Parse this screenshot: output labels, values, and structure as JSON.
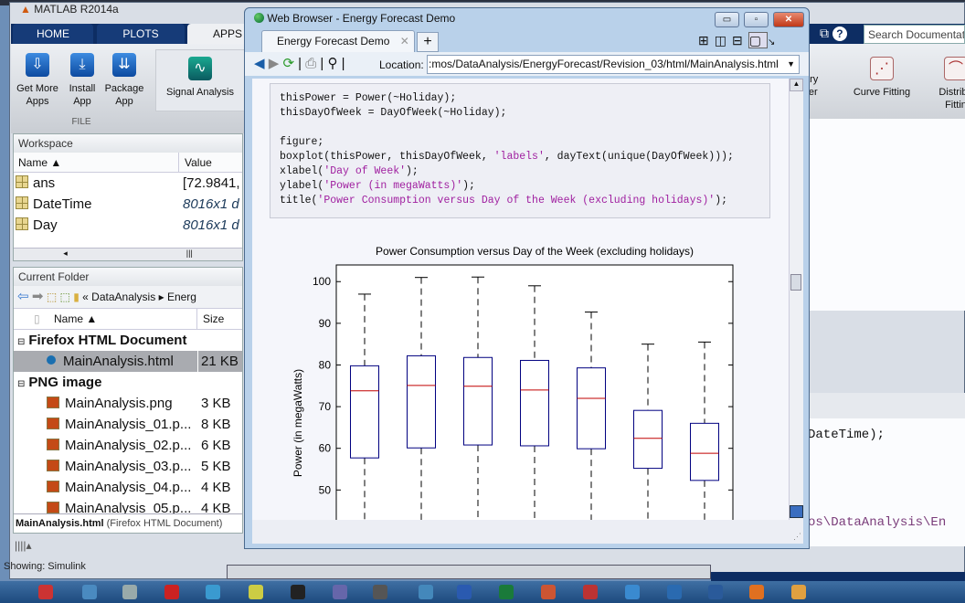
{
  "matlab": {
    "title": "MATLAB R2014a",
    "tabs": [
      "HOME",
      "PLOTS",
      "APPS"
    ],
    "ribbon": {
      "buttons": [
        "Get More\nApps",
        "Install\nApp",
        "Package\nApp"
      ],
      "group": "FILE",
      "apps": [
        "Signal Analysis",
        "ary\niler",
        "Curve Fitting",
        "Distribu\nFittin"
      ]
    },
    "search_placeholder": "Search Documentation",
    "workspace": {
      "title": "Workspace",
      "columns": [
        "Name ▲",
        "Value"
      ],
      "rows": [
        {
          "name": "ans",
          "value": "[72.9841,"
        },
        {
          "name": "DateTime",
          "value": "8016x1 d"
        },
        {
          "name": "Day",
          "value": "8016x1 d"
        }
      ]
    },
    "folder": {
      "title": "Current Folder",
      "breadcrumb": [
        "« DataAnalysis",
        "▸",
        "Energ"
      ],
      "columns": [
        "Name ▲",
        "Size"
      ],
      "groups": [
        {
          "name": "Firefox HTML Document",
          "files": [
            {
              "name": "MainAnalysis.html",
              "size": "21 KB"
            }
          ]
        },
        {
          "name": "PNG image",
          "files": [
            {
              "name": "MainAnalysis.png",
              "size": "3 KB"
            },
            {
              "name": "MainAnalysis_01.p...",
              "size": "8 KB"
            },
            {
              "name": "MainAnalysis_02.p...",
              "size": "6 KB"
            },
            {
              "name": "MainAnalysis_03.p...",
              "size": "5 KB"
            },
            {
              "name": "MainAnalysis_04.p...",
              "size": "4 KB"
            },
            {
              "name": "MainAnalysis_05.p...",
              "size": "4 KB"
            }
          ]
        }
      ],
      "details_name": "MainAnalysis.html",
      "details_type": "(Firefox HTML Document)"
    },
    "status": "Showing: Simulink",
    "command_lines": [
      "DateTime);",
      "os\\DataAnalysis\\En"
    ]
  },
  "browser": {
    "title": "Web Browser - Energy Forecast Demo",
    "tab": "Energy Forecast Demo",
    "location_label": "Location:",
    "location": ":mos/DataAnalysis/EnergyForecast/Revision_03/html/MainAnalysis.html",
    "code": [
      [
        [
          "thisPower = Power(~Holiday);",
          ""
        ]
      ],
      [
        [
          "thisDayOfWeek = DayOfWeek(~Holiday);",
          ""
        ]
      ],
      [
        [
          "",
          ""
        ]
      ],
      [
        [
          "figure;",
          ""
        ]
      ],
      [
        [
          "boxplot(thisPower, thisDayOfWeek, ",
          ""
        ],
        [
          "'labels'",
          "s"
        ],
        [
          ", dayText(unique(DayOfWeek)));",
          ""
        ]
      ],
      [
        [
          "xlabel(",
          ""
        ],
        [
          "'Day of Week'",
          "s"
        ],
        [
          ");",
          ""
        ]
      ],
      [
        [
          "ylabel(",
          ""
        ],
        [
          "'Power (in megaWatts)'",
          "s"
        ],
        [
          ");",
          ""
        ]
      ],
      [
        [
          "title(",
          ""
        ],
        [
          "'Power Consumption versus Day of the Week (excluding holidays)'",
          "s"
        ],
        [
          ");",
          ""
        ]
      ]
    ]
  },
  "chart_data": {
    "type": "boxplot",
    "title": "Power Consumption versus Day of the Week (excluding holidays)",
    "ylabel": "Power (in megaWatts)",
    "ylim": [
      41.3,
      104
    ],
    "yticks": [
      50,
      60,
      70,
      80,
      90,
      100
    ],
    "box_color": "#000080",
    "median_color": "#c00000",
    "boxes": [
      {
        "whisker_high": 97,
        "q3": 79.8,
        "median": 73.8,
        "q1": 57.7,
        "whisker_low": 41
      },
      {
        "whisker_high": 101,
        "q3": 82.2,
        "median": 75.1,
        "q1": 60.1,
        "whisker_low": 41
      },
      {
        "whisker_high": 101.1,
        "q3": 81.8,
        "median": 74.9,
        "q1": 60.8,
        "whisker_low": 41.9
      },
      {
        "whisker_high": 99,
        "q3": 81.1,
        "median": 74,
        "q1": 60.6,
        "whisker_low": 42.3
      },
      {
        "whisker_high": 92.7,
        "q3": 79.3,
        "median": 72,
        "q1": 59.9,
        "whisker_low": 42.5
      },
      {
        "whisker_high": 85,
        "q3": 69.1,
        "median": 62.4,
        "q1": 55.2,
        "whisker_low": 41.7
      },
      {
        "whisker_high": 85.5,
        "q3": 66,
        "median": 58.8,
        "q1": 52.3,
        "whisker_low": 41
      }
    ]
  }
}
